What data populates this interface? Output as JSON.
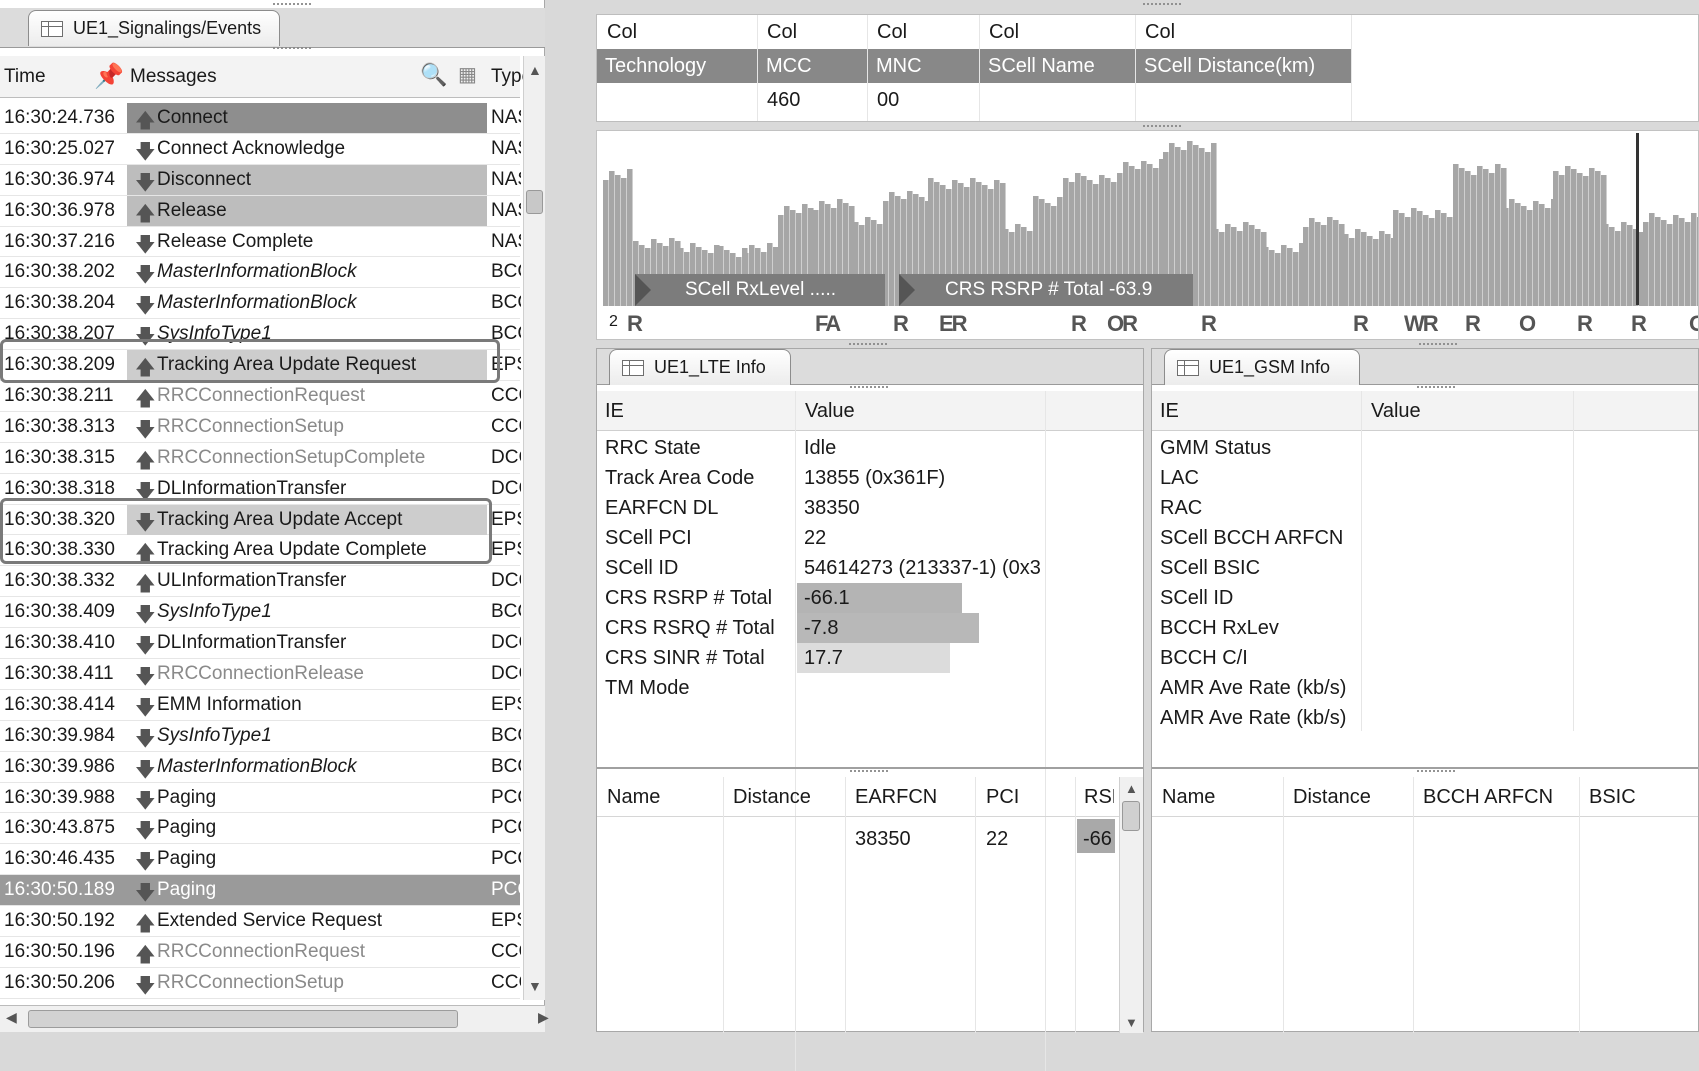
{
  "events": {
    "tab_label": "UE1_Signalings/Events",
    "columns": {
      "time": "Time",
      "messages": "Messages",
      "type": "Type"
    },
    "rows": [
      {
        "time": "16:30:24.736",
        "dir": "up",
        "msg": "Connect",
        "type": "NAS CC"
      },
      {
        "time": "16:30:25.027",
        "dir": "down",
        "msg": "Connect Acknowledge",
        "type": "NAS CC"
      },
      {
        "time": "16:30:36.974",
        "dir": "down",
        "msg": "Disconnect",
        "type": "NAS CC"
      },
      {
        "time": "16:30:36.978",
        "dir": "up",
        "msg": "Release",
        "type": "NAS CC"
      },
      {
        "time": "16:30:37.216",
        "dir": "down",
        "msg": "Release Complete",
        "type": "NAS CC"
      },
      {
        "time": "16:30:38.202",
        "dir": "down",
        "msg": "MasterInformationBlock",
        "type": "BCCH_"
      },
      {
        "time": "16:30:38.204",
        "dir": "down",
        "msg": "MasterInformationBlock",
        "type": "BCCH_"
      },
      {
        "time": "16:30:38.207",
        "dir": "down",
        "msg": "SysInfoType1",
        "type": "BCCH_"
      },
      {
        "time": "16:30:38.209",
        "dir": "up",
        "msg": "Tracking Area Update Request",
        "type": "EPS MM"
      },
      {
        "time": "16:30:38.211",
        "dir": "up",
        "msg": "RRCConnectionRequest",
        "type": "CCCH_"
      },
      {
        "time": "16:30:38.313",
        "dir": "down",
        "msg": "RRCConnectionSetup",
        "type": "CCCH_"
      },
      {
        "time": "16:30:38.315",
        "dir": "up",
        "msg": "RRCConnectionSetupComplete",
        "type": "DCCH_"
      },
      {
        "time": "16:30:38.318",
        "dir": "down",
        "msg": "DLInformationTransfer",
        "type": "DCCH_"
      },
      {
        "time": "16:30:38.320",
        "dir": "down",
        "msg": "Tracking Area Update Accept",
        "type": "EPS MM"
      },
      {
        "time": "16:30:38.330",
        "dir": "up",
        "msg": "Tracking Area Update Complete",
        "type": "EPS MM"
      },
      {
        "time": "16:30:38.332",
        "dir": "up",
        "msg": "ULInformationTransfer",
        "type": "DCCH_"
      },
      {
        "time": "16:30:38.409",
        "dir": "down",
        "msg": "SysInfoType1",
        "type": "BCCH_"
      },
      {
        "time": "16:30:38.410",
        "dir": "down",
        "msg": "DLInformationTransfer",
        "type": "DCCH_"
      },
      {
        "time": "16:30:38.411",
        "dir": "down",
        "msg": "RRCConnectionRelease",
        "type": "DCCH_"
      },
      {
        "time": "16:30:38.414",
        "dir": "down",
        "msg": "EMM Information",
        "type": "EPS MM"
      },
      {
        "time": "16:30:39.984",
        "dir": "down",
        "msg": "SysInfoType1",
        "type": "BCCH_"
      },
      {
        "time": "16:30:39.986",
        "dir": "down",
        "msg": "MasterInformationBlock",
        "type": "BCCH_"
      },
      {
        "time": "16:30:39.988",
        "dir": "down",
        "msg": "Paging",
        "type": "PCCH"
      },
      {
        "time": "16:30:43.875",
        "dir": "down",
        "msg": "Paging",
        "type": "PCCH"
      },
      {
        "time": "16:30:46.435",
        "dir": "down",
        "msg": "Paging",
        "type": "PCCH"
      },
      {
        "time": "16:30:50.189",
        "dir": "down",
        "msg": "Paging",
        "type": "PCCH"
      },
      {
        "time": "16:30:50.192",
        "dir": "up",
        "msg": "Extended Service Request",
        "type": "EPS MM"
      },
      {
        "time": "16:30:50.196",
        "dir": "up",
        "msg": "RRCConnectionRequest",
        "type": "CCCH_"
      },
      {
        "time": "16:30:50.206",
        "dir": "down",
        "msg": "RRCConnectionSetup",
        "type": "CCCH_"
      }
    ]
  },
  "cell_grid": {
    "col_labels": [
      "Col",
      "Col",
      "Col",
      "Col",
      "Col"
    ],
    "headers": [
      "Technology",
      "MCC",
      "MNC",
      "SCell Name",
      "SCell Distance(km)"
    ],
    "values": [
      "",
      "460",
      "00",
      "",
      ""
    ]
  },
  "trend": {
    "legend1": "SCell RxLevel  .....",
    "legend2": "CRS RSRP # Total  -63.9",
    "marker_count": "2",
    "event_marks": [
      "R",
      "FA",
      "R",
      "ER",
      "R",
      "OR",
      "R",
      "R",
      "WR",
      "R",
      "O",
      "R",
      "R",
      "O"
    ]
  },
  "lte_info": {
    "tab_label": "UE1_LTE Info",
    "col_ie": "IE",
    "col_value": "Value",
    "rows": [
      {
        "ie": "RRC State",
        "value": "Idle"
      },
      {
        "ie": "Track Area Code",
        "value": "13855 (0x361F)"
      },
      {
        "ie": "EARFCN DL",
        "value": "38350"
      },
      {
        "ie": "SCell PCI",
        "value": "22"
      },
      {
        "ie": "SCell ID",
        "value": "54614273 (213337-1) (0x3"
      },
      {
        "ie": "CRS RSRP # Total",
        "value": "-66.1"
      },
      {
        "ie": "CRS RSRQ # Total",
        "value": "-7.8"
      },
      {
        "ie": "CRS SINR # Total",
        "value": "17.7"
      },
      {
        "ie": "TM Mode",
        "value": ""
      }
    ],
    "neighbors": {
      "columns": [
        "Name",
        "Distance",
        "EARFCN",
        "PCI",
        "RSF"
      ],
      "row": [
        "",
        "",
        "38350",
        "22",
        "-66"
      ]
    }
  },
  "gsm_info": {
    "tab_label": "UE1_GSM Info",
    "col_ie": "IE",
    "col_value": "Value",
    "rows": [
      "GMM Status",
      "LAC",
      "RAC",
      "SCell BCCH ARFCN",
      "SCell BSIC",
      "SCell ID",
      "BCCH RxLev",
      "BCCH C/I",
      "AMR Ave Rate (kb/s)",
      "AMR Ave Rate (kb/s)"
    ],
    "neighbors": {
      "columns": [
        "Name",
        "Distance",
        "BCCH ARFCN",
        "BSIC"
      ]
    }
  }
}
